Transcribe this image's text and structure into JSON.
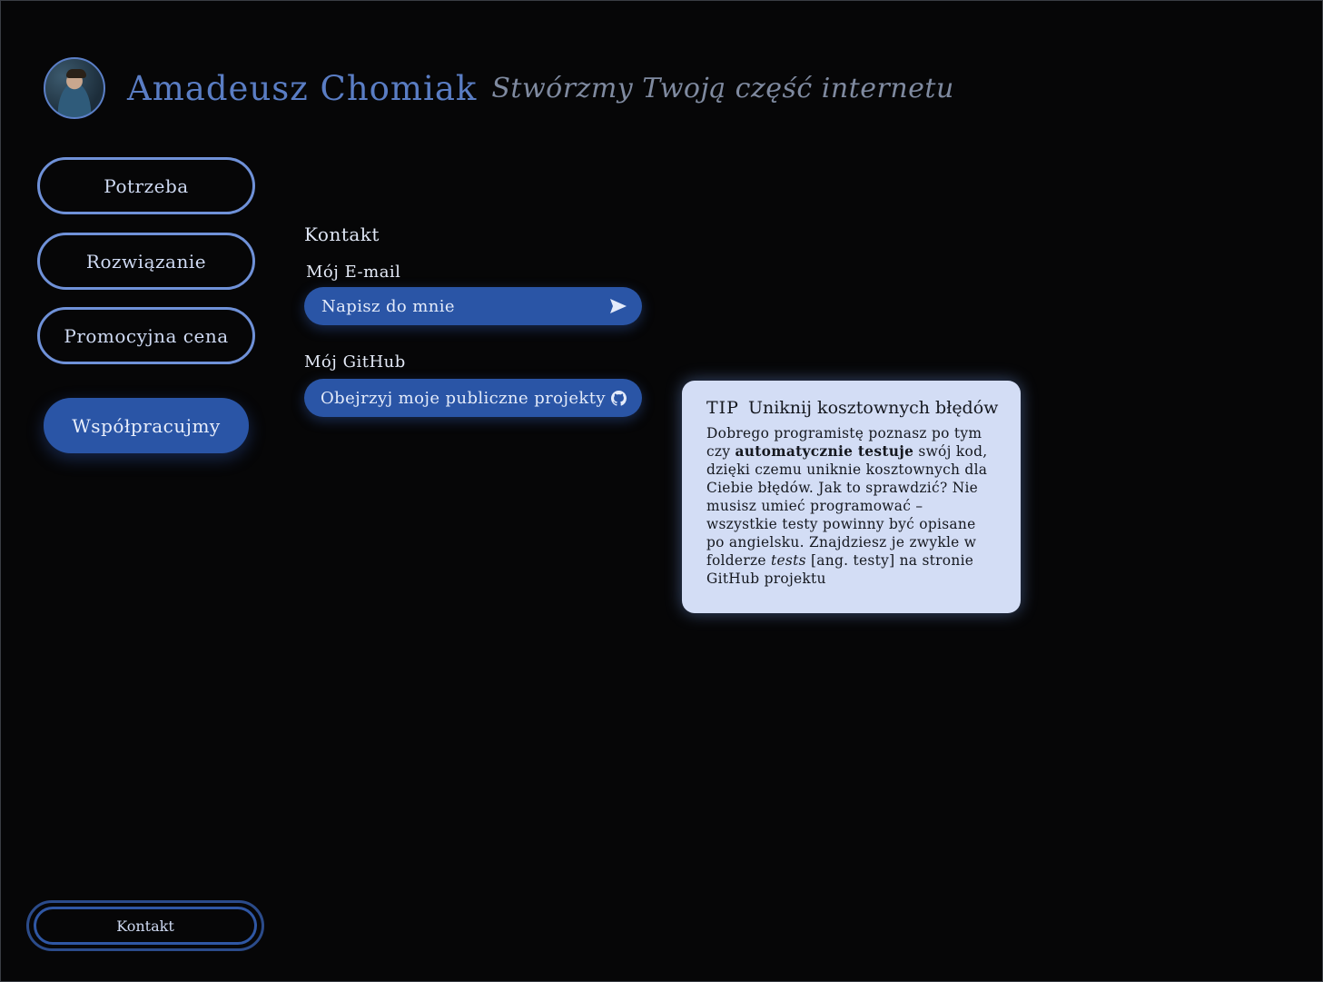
{
  "header": {
    "name": "Amadeusz Chomiak",
    "tagline": "Stwórzmy Twoją część internetu"
  },
  "nav": {
    "items": [
      {
        "label": "Potrzeba"
      },
      {
        "label": "Rozwiązanie"
      },
      {
        "label": "Promocyjna cena"
      }
    ],
    "primary_label": "Współpracujmy",
    "bottom_label": "Kontakt"
  },
  "contact": {
    "title": "Kontakt",
    "email_label": "Mój E-mail",
    "email_button": "Napisz do mnie",
    "email_icon": "send-icon",
    "github_label": "Mój GitHub",
    "github_button": "Obejrzyj moje publiczne projekty",
    "github_icon": "github-icon"
  },
  "tip": {
    "tag": "TIP",
    "title": "Uniknij kosztownych błędów",
    "body_1": "Dobrego programistę poznasz po tym czy ",
    "body_bold": "automatycznie testuje",
    "body_2": " swój kod, dzięki czemu uniknie kosztownych dla Ciebie błędów. Jak to sprawdzić? Nie musisz umieć programować – wszystkie testy powinny być opisane po angielsku. Znajdziesz je zwykle w folderze ",
    "body_italic": "tests",
    "body_3": " [ang. testy] na stronie GitHub projektu"
  },
  "colors": {
    "background": "#060607",
    "accent": "#2a55a6",
    "outline": "#6f91d8",
    "tip_background": "#d3ddf5"
  }
}
